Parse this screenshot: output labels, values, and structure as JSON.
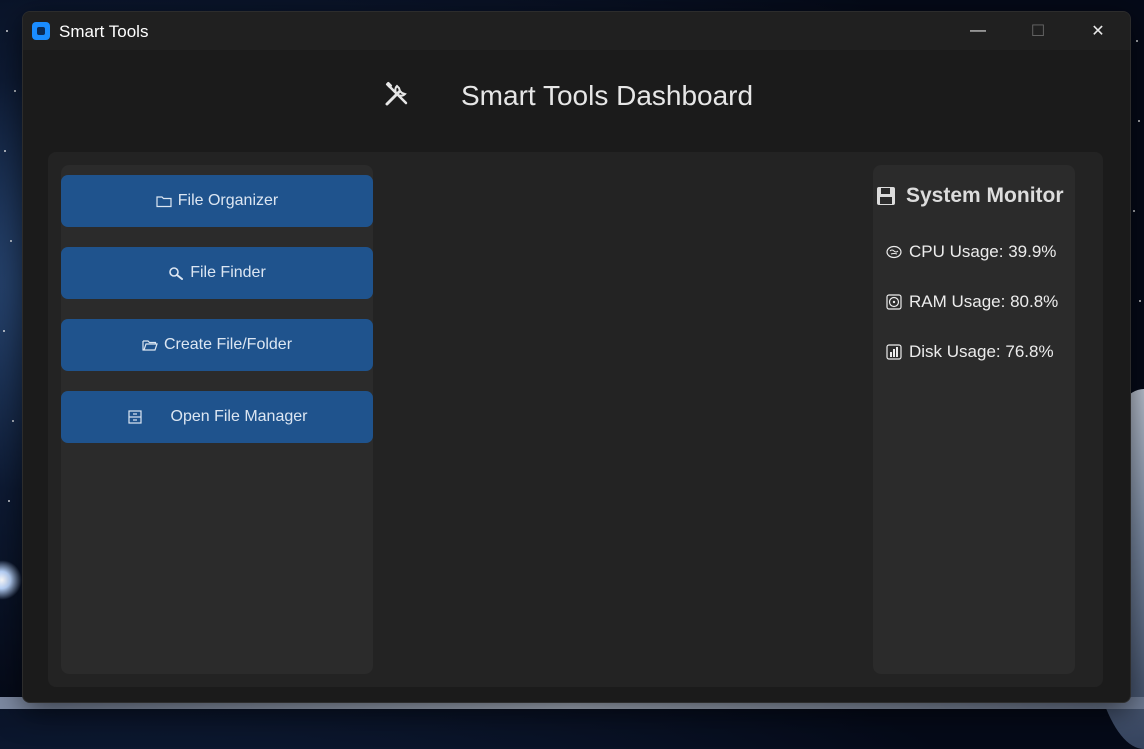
{
  "window": {
    "title": "Smart Tools",
    "controls": {
      "minimize": "—",
      "maximize": "☐",
      "close": "✕"
    }
  },
  "header": {
    "title": "Smart Tools Dashboard",
    "icon": "tools-icon"
  },
  "sidebar": {
    "buttons": [
      {
        "label": "File Organizer",
        "icon": "folder-icon"
      },
      {
        "label": "File Finder",
        "icon": "magnifier-icon"
      },
      {
        "label": "Create File/Folder",
        "icon": "open-folder-icon"
      },
      {
        "label": "Open File Manager",
        "icon": "file-cabinet-icon"
      }
    ]
  },
  "monitor": {
    "title": "System Monitor",
    "icon": "floppy-disk-icon",
    "stats": [
      {
        "label": "CPU Usage: 39.9%",
        "icon": "brain-icon"
      },
      {
        "label": "RAM Usage: 80.8%",
        "icon": "disc-icon"
      },
      {
        "label": "Disk Usage: 76.8%",
        "icon": "bar-chart-icon"
      }
    ]
  },
  "colors": {
    "button": "#1f538d",
    "window_bg": "#1b1b1b",
    "panel_bg": "#232323",
    "card_bg": "#2b2b2b",
    "accent": "#1a8cff"
  }
}
